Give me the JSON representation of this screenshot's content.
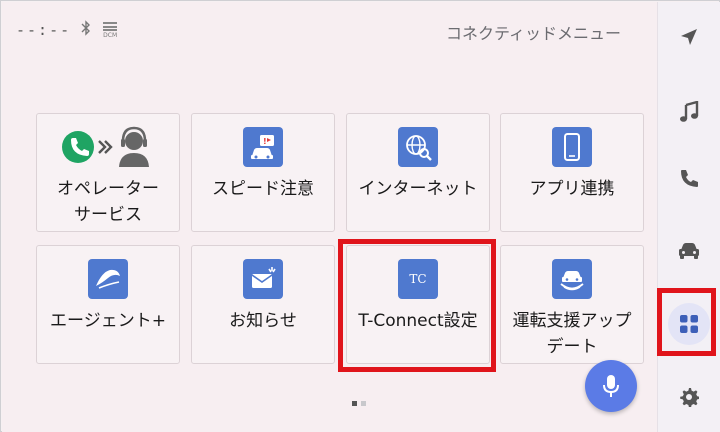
{
  "status": {
    "clock": "--:--",
    "bluetooth_icon": "bluetooth-icon",
    "dcm_label": "DCM"
  },
  "header": {
    "title": "コネクティッドメニュー"
  },
  "tiles": [
    {
      "label": "オペレーター\nサービス",
      "icon": "operator-headset-icon"
    },
    {
      "label": "スピード注意",
      "icon": "speed-warning-icon"
    },
    {
      "label": "インターネット",
      "icon": "internet-globe-icon"
    },
    {
      "label": "アプリ連携",
      "icon": "smartphone-icon"
    },
    {
      "label": "エージェント+",
      "icon": "agent-icon"
    },
    {
      "label": "お知らせ",
      "icon": "mail-notification-icon"
    },
    {
      "label": "T-Connect設定",
      "icon": "tc-logo-icon",
      "icon_text": "TC"
    },
    {
      "label": "運転支援アップ\nデート",
      "icon": "driving-support-update-icon"
    }
  ],
  "sidebar": {
    "items": [
      {
        "name": "navigation",
        "icon": "navigation-arrow-icon"
      },
      {
        "name": "music",
        "icon": "music-note-icon"
      },
      {
        "name": "phone",
        "icon": "phone-icon"
      },
      {
        "name": "vehicle",
        "icon": "car-icon"
      },
      {
        "name": "apps",
        "icon": "apps-grid-icon",
        "active": true
      },
      {
        "name": "settings",
        "icon": "gear-icon"
      }
    ]
  },
  "pager": {
    "pages": 2,
    "current": 1
  },
  "colors": {
    "accent": "#4f79cf",
    "highlight": "#e0141b",
    "mic": "#5b7be6"
  }
}
